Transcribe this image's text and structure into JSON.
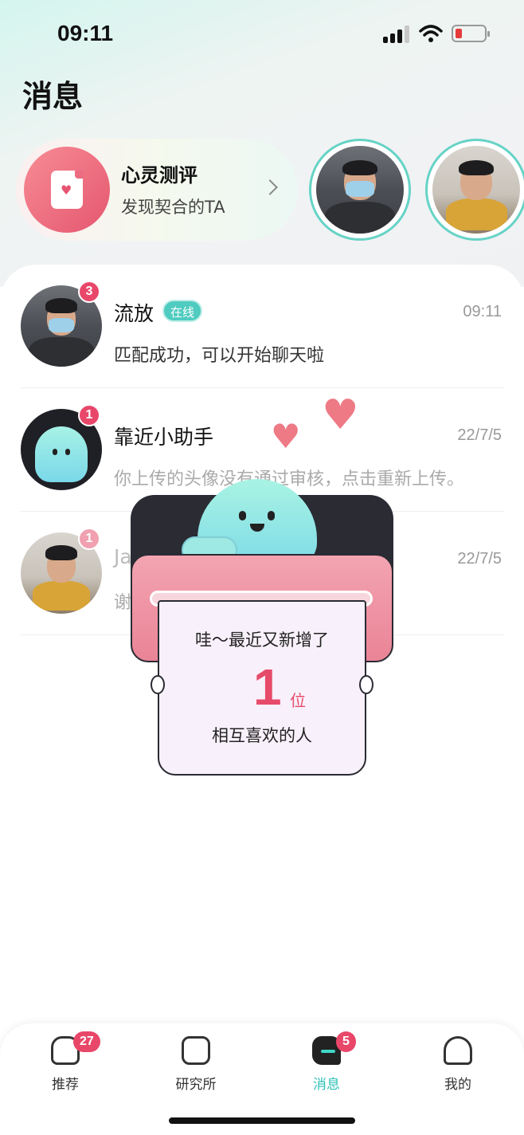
{
  "status_bar": {
    "time": "09:11"
  },
  "page_title": "消息",
  "test_card": {
    "title": "心灵测评",
    "subtitle": "发现契合的TA"
  },
  "stories": [
    "story-1",
    "story-2"
  ],
  "messages": [
    {
      "name": "流放",
      "online_tag": "在线",
      "time": "09:11",
      "preview": "匹配成功，可以开始聊天啦",
      "unread": "3"
    },
    {
      "name": "靠近小助手",
      "time": "22/7/5",
      "preview": "你上传的头像没有通过审核，点击重新上传。",
      "unread": "1"
    },
    {
      "name": "Ja",
      "time": "22/7/5",
      "preview": "谢…浏览了你的…",
      "unread": "1"
    }
  ],
  "popup": {
    "line1": "哇～最近又新增了",
    "count": "1",
    "unit": "位",
    "line2": "相互喜欢的人"
  },
  "tabbar": {
    "tabs": [
      {
        "label": "推荐",
        "badge": "27",
        "icon": "home-heart-icon"
      },
      {
        "label": "研究所",
        "badge": "",
        "icon": "lab-icon"
      },
      {
        "label": "消息",
        "badge": "5",
        "icon": "message-ghost-icon",
        "active": true
      },
      {
        "label": "我的",
        "badge": "",
        "icon": "ghost-profile-icon"
      }
    ]
  },
  "colors": {
    "accent": "#2ec1b5",
    "badge": "#e8476a",
    "online": "#4fcbbf"
  }
}
